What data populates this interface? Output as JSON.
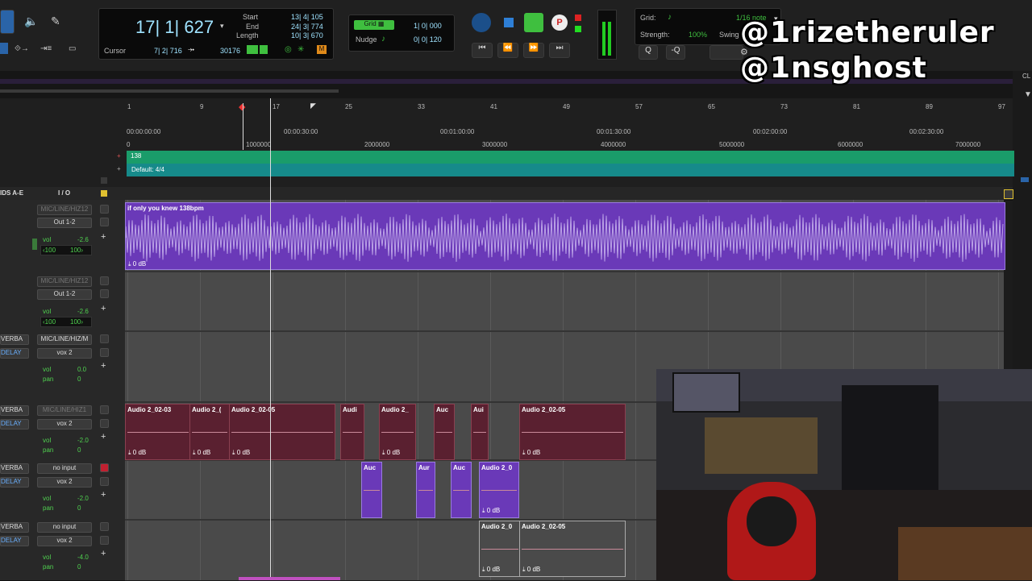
{
  "transport": {
    "main_counter": "17| 1| 627",
    "cursor_label": "Cursor",
    "cursor_value": "7| 2| 716",
    "cursor_samples": "30176",
    "start_label": "Start",
    "end_label": "End",
    "length_label": "Length",
    "start_value": "13| 4| 105",
    "end_value": "24| 3| 774",
    "length_value": "10| 3| 670",
    "grid_label": "Grid",
    "grid_value": "1| 0| 000",
    "nudge_label": "Nudge",
    "nudge_value": "0| 0| 120",
    "quant_grid_label": "Grid:",
    "quant_grid_value": "1/16 note",
    "strength_label": "Strength:",
    "strength_value": "100%",
    "swing_label": "Swing"
  },
  "watermark": {
    "line1": "@1rizetheruler",
    "line2": "@1nsghost"
  },
  "ruler": {
    "bars": [
      "1",
      "9",
      "17",
      "25",
      "33",
      "41",
      "49",
      "57",
      "65",
      "73",
      "81",
      "89",
      "97"
    ],
    "timecodes": [
      "00:00:00:00",
      "00:00:30:00",
      "00:01:00:00",
      "00:01:30:00",
      "00:02:00:00",
      "00:02:30:00"
    ],
    "samples": [
      "0",
      "1000000",
      "2000000",
      "3000000",
      "4000000",
      "5000000",
      "6000000",
      "7000000"
    ],
    "tempo": "138",
    "meter": "Default: 4/4"
  },
  "header": {
    "inserts_label": "IDS A-E",
    "io_label": "I / O"
  },
  "tracks": [
    {
      "input": "MIC/LINE/HIZ12",
      "output": "Out 1-2",
      "vol": "-2.6",
      "pan_l": "‹100",
      "pan_r": "100›",
      "clips": [
        {
          "name": "if only you knew 138bpm",
          "gain": "0 dB"
        }
      ]
    },
    {
      "input": "MIC/LINE/HIZ12",
      "output": "Out 1-2",
      "vol": "-2.6",
      "pan_l": "‹100",
      "pan_r": "100›",
      "clips": []
    },
    {
      "insert1": "VERBA",
      "insert2": "DELAY",
      "input": "MIC/LINE/HIZ/M",
      "output": "vox 2",
      "vol": "0.0",
      "pan": "0",
      "clips": []
    },
    {
      "insert1": "VERBA",
      "insert2": "DELAY",
      "input": "MIC/LINE/HIZ1",
      "output": "vox 2",
      "vol": "-2.0",
      "pan": "0",
      "clips": [
        {
          "name": "Audio 2_02-03",
          "gain": "0 dB"
        },
        {
          "name": "Audio 2_(",
          "gain": "0 dB"
        },
        {
          "name": "Audio 2_02-05",
          "gain": "0 dB"
        },
        {
          "name": "Audi",
          "gain": ""
        },
        {
          "name": "Audio 2_",
          "gain": "0 dB"
        },
        {
          "name": "Auc",
          "gain": ""
        },
        {
          "name": "Aui",
          "gain": ""
        },
        {
          "name": "Audio 2_02-05",
          "gain": "0 dB"
        }
      ]
    },
    {
      "insert1": "VERBA",
      "insert2": "DELAY",
      "input": "no input",
      "output": "vox 2",
      "vol": "-2.0",
      "pan": "0",
      "clips": [
        {
          "name": "Auc",
          "gain": ""
        },
        {
          "name": "Aur",
          "gain": ""
        },
        {
          "name": "Auc",
          "gain": ""
        },
        {
          "name": "Audio 2_0",
          "gain": "0 dB"
        }
      ]
    },
    {
      "insert1": "VERBA",
      "insert2": "DELAY",
      "input": "no input",
      "output": "vox 2",
      "vol": "-4.0",
      "pan": "0",
      "clips": [
        {
          "name": "Audio 2_0",
          "gain": "0 dB"
        },
        {
          "name": "Audio 2_02-05",
          "gain": "0 dB"
        }
      ]
    }
  ],
  "labels": {
    "vol": "vol",
    "pan": "pan"
  },
  "colors": {
    "accent": "#6a39b8",
    "tempo_bar": "#1a9c6a",
    "meter_bar": "#168a8a"
  }
}
